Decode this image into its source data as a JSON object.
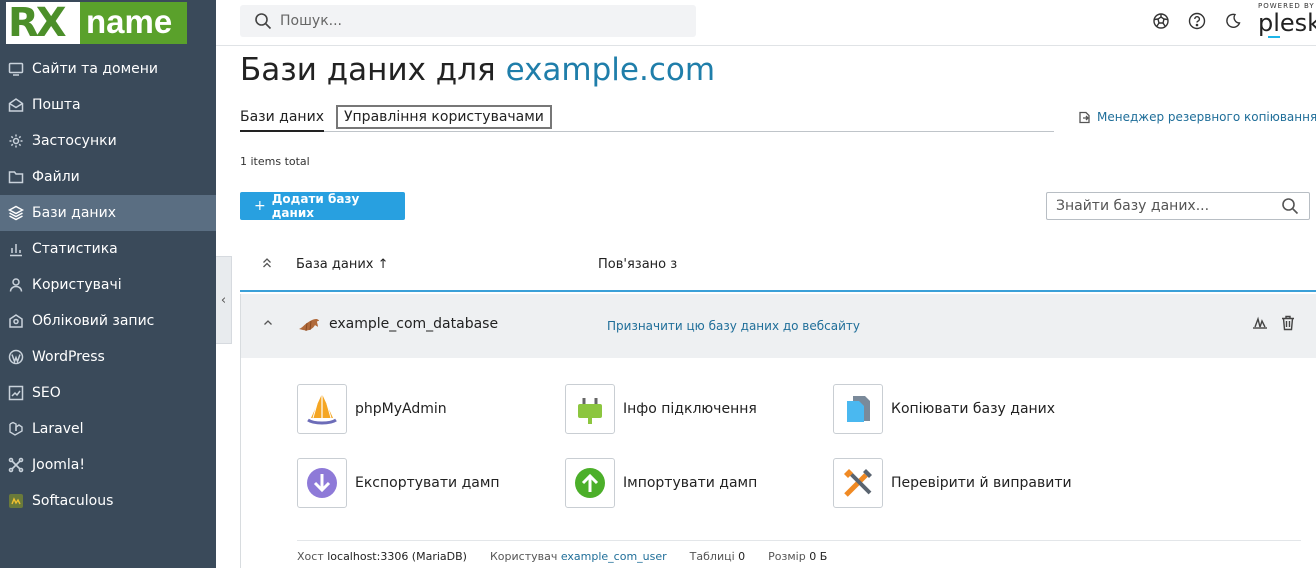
{
  "logo": {
    "part1": "RX",
    "part2": "name"
  },
  "sidebar": {
    "items": [
      {
        "label": "Сайти та домени",
        "icon": "monitor-icon"
      },
      {
        "label": "Пошта",
        "icon": "envelope-icon"
      },
      {
        "label": "Застосунки",
        "icon": "gear-icon"
      },
      {
        "label": "Файли",
        "icon": "folder-icon"
      },
      {
        "label": "Бази даних",
        "icon": "layers-icon",
        "active": true
      },
      {
        "label": "Статистика",
        "icon": "bar-chart-icon"
      },
      {
        "label": "Користувачі",
        "icon": "user-icon"
      },
      {
        "label": "Обліковий запис",
        "icon": "account-icon"
      },
      {
        "label": "WordPress",
        "icon": "wordpress-icon"
      },
      {
        "label": "SEO",
        "icon": "seo-icon"
      },
      {
        "label": "Laravel",
        "icon": "laravel-icon"
      },
      {
        "label": "Joomla!",
        "icon": "joomla-icon"
      },
      {
        "label": "Softaculous",
        "icon": "softaculous-icon"
      }
    ],
    "collapse_glyph": "‹"
  },
  "topbar": {
    "search_placeholder": "Пошук...",
    "powered_by": "POWERED BY",
    "plesk": "plesk"
  },
  "page": {
    "title_prefix": "Бази даних для",
    "title_domain": "example.com",
    "tab_databases": "Бази даних",
    "tab_users": "Управління користувачами",
    "backup_link": "Менеджер резервного копіювання",
    "items_total": "1 items total",
    "add_button": "Додати базу даних",
    "add_plus": "+",
    "db_search_placeholder": "Знайти базу даних..."
  },
  "table": {
    "col_database": "База даних ↑",
    "col_related": "Пов'язано з",
    "sort_glyph": "⌃⌃",
    "row": {
      "name": "example_com_database",
      "assign_link": "Призначити цю базу даних до вебсайту",
      "chevron": "⌃"
    }
  },
  "tools": {
    "phpmyadmin": "phpMyAdmin",
    "connection_info": "Інфо підключення",
    "copy_db": "Копіювати базу даних",
    "export_dump": "Експортувати дамп",
    "import_dump": "Імпортувати дамп",
    "check_repair": "Перевірити й виправити"
  },
  "info": {
    "host_label": "Хост",
    "host_value": "localhost:3306 (MariaDB)",
    "user_label": "Користувач",
    "user_value": "example_com_user",
    "tables_label": "Таблиці",
    "tables_value": "0",
    "size_label": "Розмір",
    "size_value": "0 Б"
  },
  "colors": {
    "sidebar_bg": "#3a4a5a",
    "sidebar_active": "#5a6e82",
    "accent_blue": "#28a0e0",
    "link_blue": "#1f6e99",
    "logo_green": "#5aa12b"
  }
}
